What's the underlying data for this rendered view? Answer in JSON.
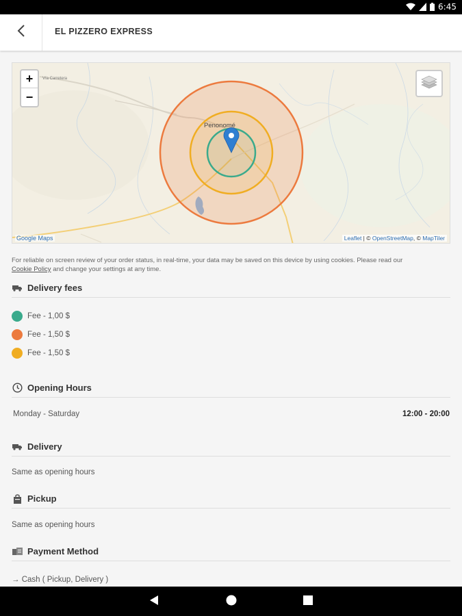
{
  "status": {
    "time": "6:45"
  },
  "header": {
    "title": "EL PIZZERO EXPRESS"
  },
  "map": {
    "zoom_in": "+",
    "zoom_out": "−",
    "city_label": "Penonomé",
    "google_label": "Google Maps",
    "attribution": {
      "leaflet": "Leaflet",
      "sep1": " | © ",
      "osm": "OpenStreetMap",
      "sep2": ", © ",
      "maptiler": "MapTiler"
    }
  },
  "cookie": {
    "text": "For reliable on screen review of your order status, in real-time, your data may be saved on this device by using cookies. Please read our",
    "link": "Cookie Policy",
    "suffix": " and change your settings at any time."
  },
  "delivery_fees": {
    "title": "Delivery fees",
    "items": [
      {
        "label": "Fee - 1,00 $",
        "color": "#3aaa8c"
      },
      {
        "label": "Fee - 1,50 $",
        "color": "#ec7a3e"
      },
      {
        "label": "Fee - 1,50 $",
        "color": "#f0ad22"
      }
    ]
  },
  "opening_hours": {
    "title": "Opening Hours",
    "days": "Monday - Saturday",
    "hours": "12:00 - 20:00"
  },
  "delivery": {
    "title": "Delivery",
    "text": "Same as opening hours"
  },
  "pickup": {
    "title": "Pickup",
    "text": "Same as opening hours"
  },
  "payment": {
    "title": "Payment Method",
    "item": "→  Cash ( Pickup, Delivery )"
  },
  "colors": {
    "orange_zone": "#ec7a3e",
    "yellow_zone": "#f0ad22",
    "green_zone": "#3aaa8c",
    "pin": "#2f7fd1"
  },
  "icons": [
    "back-arrow-icon",
    "wifi-icon",
    "signal-icon",
    "battery-icon",
    "layers-icon",
    "map-pin-icon",
    "truck-icon",
    "clock-icon",
    "bag-icon",
    "cash-icon",
    "nav-back-icon",
    "nav-home-icon",
    "nav-recents-icon"
  ]
}
